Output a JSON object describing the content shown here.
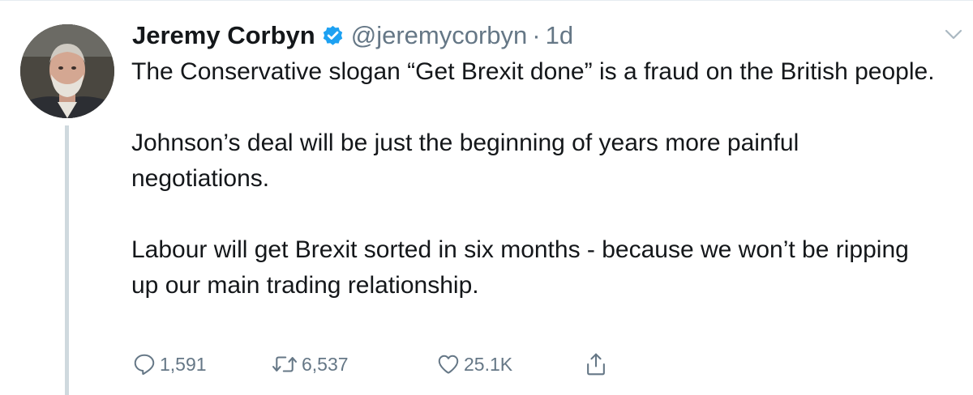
{
  "tweet": {
    "author_name": "Jeremy Corbyn",
    "handle": "@jeremycorbyn",
    "separator": "·",
    "time": "1d",
    "paragraphs": [
      "The Conservative slogan “Get Brexit done” is a fraud on the British people.",
      "Johnson’s deal will be just the beginning of years more painful negotiations.",
      "Labour will get Brexit sorted in six months - because we won’t be ripping up our main trading relationship."
    ],
    "replies": "1,591",
    "retweets": "6,537",
    "likes": "25.1K"
  },
  "icons": {
    "verified": "verified-badge-icon",
    "menu": "chevron-down-icon",
    "reply": "reply-icon",
    "retweet": "retweet-icon",
    "like": "heart-icon",
    "share": "share-icon"
  },
  "colors": {
    "text": "#14171a",
    "secondary": "#657786",
    "verified": "#1da1f2",
    "thread_line": "#cfd9de"
  }
}
